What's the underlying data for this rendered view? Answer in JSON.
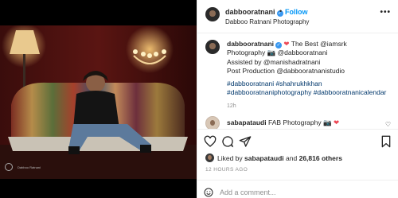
{
  "post": {
    "header": {
      "username": "dabbooratnani",
      "follow_label": "Follow",
      "subtitle": "Dabboo Ratnani Photography",
      "more_label": "•••",
      "separator": "•"
    },
    "caption": {
      "username": "dabbooratnani",
      "line1_after_heart": "The Best @iamsrk",
      "line2": "Photography 📷 @dabbooratnani",
      "line3": "Assisted by @manishadratnani",
      "line4": "Post Production @dabbooratnanistudio",
      "line5": "#dabbooratnani #shahrukhkhan",
      "line6": "#dabbooratnaniphotography #dabbooratnanicalendar",
      "time": "12h"
    },
    "comment": {
      "username": "sabapataudi",
      "text": "FAB Photography 📷"
    },
    "likes": {
      "prefix": "Liked by",
      "user": "sabapataudi",
      "conjunction": "and",
      "others": "26,816 others"
    },
    "posted_ago": "12 HOURS AGO",
    "add_comment": {
      "placeholder": "Add a comment..."
    },
    "photo_signature": "Dabboo Ratnani"
  },
  "colors": {
    "accent": "#0095f6",
    "verified": "#3897f0",
    "heart": "#ed4956"
  }
}
